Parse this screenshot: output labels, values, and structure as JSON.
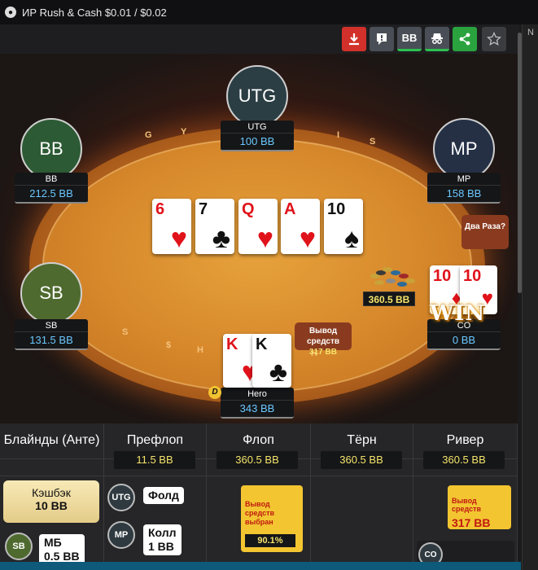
{
  "window": {
    "title": "ИР  Rush & Cash $0.01 / $0.02",
    "logo": "●"
  },
  "right_strip": {
    "label": "N"
  },
  "toolbar": {
    "buttons": [
      {
        "name": "download",
        "icon": "download-icon",
        "color": "#d2302a"
      },
      {
        "name": "note",
        "icon": "note-flag-icon",
        "color": "#4a4e56"
      },
      {
        "name": "bb",
        "label": "BB",
        "color": "#4a4e56"
      },
      {
        "name": "anonymous",
        "icon": "spy-icon",
        "color": "#4a4e56"
      },
      {
        "name": "share",
        "icon": "share-icon",
        "color": "#2aa33f"
      },
      {
        "name": "favorite",
        "icon": "star-icon",
        "color": "#3a3c40"
      }
    ]
  },
  "table": {
    "rim_letters": [
      "G",
      "Y",
      "I",
      "S"
    ],
    "rim_bottom": [
      "S",
      "H",
      "S",
      "H",
      "$"
    ],
    "seats": {
      "utg": {
        "avatar": "UTG",
        "name": "UTG",
        "stack": "100 BB",
        "color": "#2a3e44"
      },
      "bb": {
        "avatar": "BB",
        "name": "BB",
        "stack": "212.5 BB",
        "color": "#2c5a34"
      },
      "mp": {
        "avatar": "MP",
        "name": "MP",
        "stack": "158 BB",
        "color": "#253045"
      },
      "sb": {
        "avatar": "SB",
        "name": "SB",
        "stack": "131.5 BB",
        "color": "#4e6a2e"
      },
      "co": {
        "name": "CO",
        "stack": "0 BB"
      },
      "hero": {
        "name": "Hero",
        "stack": "343 BB"
      }
    },
    "board": [
      {
        "rank": "6",
        "suit": "♥",
        "color": "red"
      },
      {
        "rank": "7",
        "suit": "♣",
        "color": "black"
      },
      {
        "rank": "Q",
        "suit": "♥",
        "color": "red"
      },
      {
        "rank": "A",
        "suit": "♥",
        "color": "red"
      },
      {
        "rank": "10",
        "suit": "♠",
        "color": "black"
      }
    ],
    "hero_cards": [
      {
        "rank": "K",
        "suit": "♥",
        "color": "red"
      },
      {
        "rank": "K",
        "suit": "♣",
        "color": "black"
      }
    ],
    "co_cards": [
      {
        "rank": "10",
        "suit": "♦",
        "color": "red"
      },
      {
        "rank": "10",
        "suit": "♥",
        "color": "red"
      }
    ],
    "pot": "360.5 BB",
    "win_badge": "WIN",
    "dealer_button": "D",
    "bubble_co": "Два Раза?",
    "bubble_hero_title": "Вывод средств",
    "bubble_hero_value": "317 BB"
  },
  "streets": {
    "blinds": {
      "header": "Блайнды (Анте)"
    },
    "preflop": {
      "header": "Префлоп",
      "pot": "11.5 BB"
    },
    "flop": {
      "header": "Флоп",
      "pot": "360.5 BB"
    },
    "turn": {
      "header": "Тёрн",
      "pot": "360.5 BB"
    },
    "river": {
      "header": "Ривер",
      "pot": "360.5 BB"
    }
  },
  "blinds_col": {
    "cashback_title": "Кэшбэк",
    "cashback_value": "10 BB",
    "sb_badge": "SB",
    "sb_action": "МБ",
    "sb_amount": "0.5 BB"
  },
  "preflop_col": {
    "a1_pos": "UTG",
    "a1_action": "Фолд",
    "a2_pos": "MP",
    "a2_action": "Колл",
    "a2_amount": "1 BB"
  },
  "flop_col": {
    "note_title": "Вывод средств выбран",
    "note_value": "90.1%"
  },
  "river_col": {
    "note_title": "Вывод средств",
    "note_value": "317 BB",
    "badge": "CO"
  }
}
